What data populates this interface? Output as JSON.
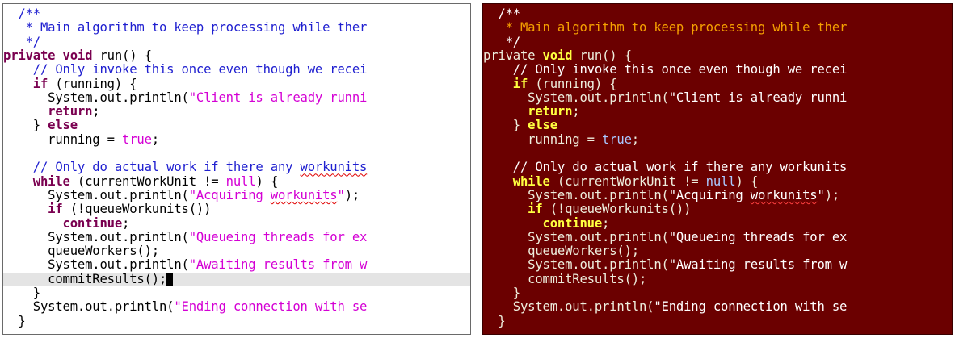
{
  "editors": [
    {
      "theme": "light",
      "lines": [
        [
          {
            "t": "  /**",
            "c": "cm"
          }
        ],
        [
          {
            "t": "   * Main algorithm to keep processing while ther",
            "c": "cm"
          }
        ],
        [
          {
            "t": "   */",
            "c": "cm"
          }
        ],
        [
          {
            "t": "private",
            "c": "kw"
          },
          {
            "t": " ",
            "c": "t"
          },
          {
            "t": "void",
            "c": "kw"
          },
          {
            "t": " run() {",
            "c": "t"
          }
        ],
        [
          {
            "t": "    // Only invoke this once even though we recei",
            "c": "cm"
          }
        ],
        [
          {
            "t": "    ",
            "c": "t"
          },
          {
            "t": "if",
            "c": "kw"
          },
          {
            "t": " (running) {",
            "c": "t"
          }
        ],
        [
          {
            "t": "      System.out.println(",
            "c": "t"
          },
          {
            "t": "\"Client is already runni",
            "c": "str"
          }
        ],
        [
          {
            "t": "      ",
            "c": "t"
          },
          {
            "t": "return",
            "c": "kw"
          },
          {
            "t": ";",
            "c": "t"
          }
        ],
        [
          {
            "t": "    } ",
            "c": "t"
          },
          {
            "t": "else",
            "c": "kw"
          }
        ],
        [
          {
            "t": "      running = ",
            "c": "t"
          },
          {
            "t": "true",
            "c": "str"
          },
          {
            "t": ";",
            "c": "t"
          }
        ],
        [],
        [
          {
            "t": "    // Only do actual work if there any ",
            "c": "cm"
          },
          {
            "t": "workunits",
            "c": "cm sq"
          }
        ],
        [
          {
            "t": "    ",
            "c": "t"
          },
          {
            "t": "while",
            "c": "kw"
          },
          {
            "t": " (currentWorkUnit != ",
            "c": "t"
          },
          {
            "t": "null",
            "c": "str"
          },
          {
            "t": ") {",
            "c": "t"
          }
        ],
        [
          {
            "t": "      System.out.println(",
            "c": "t"
          },
          {
            "t": "\"Acquiring ",
            "c": "str"
          },
          {
            "t": "workunits",
            "c": "str sq"
          },
          {
            "t": "\"",
            "c": "str"
          },
          {
            "t": ");",
            "c": "t"
          }
        ],
        [
          {
            "t": "      ",
            "c": "t"
          },
          {
            "t": "if",
            "c": "kw"
          },
          {
            "t": " (!queueWorkunits())",
            "c": "t"
          }
        ],
        [
          {
            "t": "        ",
            "c": "t"
          },
          {
            "t": "continue",
            "c": "kw"
          },
          {
            "t": ";",
            "c": "t"
          }
        ],
        [
          {
            "t": "      System.out.println(",
            "c": "t"
          },
          {
            "t": "\"Queueing threads for ex",
            "c": "str"
          }
        ],
        [
          {
            "t": "      queueWorkers();",
            "c": "t"
          }
        ],
        [
          {
            "t": "      System.out.println(",
            "c": "t"
          },
          {
            "t": "\"Awaiting results from w",
            "c": "str"
          }
        ],
        [
          {
            "t": "      commitResults();",
            "c": "t"
          }
        ],
        [
          {
            "t": "    }",
            "c": "t"
          }
        ],
        [
          {
            "t": "    System.out.println(",
            "c": "t"
          },
          {
            "t": "\"Ending connection with se",
            "c": "str"
          }
        ],
        [
          {
            "t": "  }",
            "c": "t"
          }
        ]
      ]
    },
    {
      "theme": "dark",
      "lines": [
        [
          {
            "t": "  /**",
            "c": "cm"
          }
        ],
        [
          {
            "t": "   * Main algorithm to keep processing while ther",
            "c": "cm2"
          }
        ],
        [
          {
            "t": "   */",
            "c": "cm"
          }
        ],
        [
          {
            "t": "private",
            "c": "t"
          },
          {
            "t": " ",
            "c": "t"
          },
          {
            "t": "void",
            "c": "kw"
          },
          {
            "t": " run() {",
            "c": "t"
          }
        ],
        [
          {
            "t": "    // Only invoke this once even though we recei",
            "c": "cm"
          }
        ],
        [
          {
            "t": "    ",
            "c": "t"
          },
          {
            "t": "if",
            "c": "kw"
          },
          {
            "t": " (running) {",
            "c": "t"
          }
        ],
        [
          {
            "t": "      System.out.println(",
            "c": "t"
          },
          {
            "t": "\"Client is already runni",
            "c": "str"
          }
        ],
        [
          {
            "t": "      ",
            "c": "t"
          },
          {
            "t": "return",
            "c": "kw"
          },
          {
            "t": ";",
            "c": "t"
          }
        ],
        [
          {
            "t": "    } ",
            "c": "t"
          },
          {
            "t": "else",
            "c": "kw"
          }
        ],
        [
          {
            "t": "      running = ",
            "c": "t"
          },
          {
            "t": "true",
            "c": "lit"
          },
          {
            "t": ";",
            "c": "t"
          }
        ],
        [],
        [
          {
            "t": "    // Only do actual work if there any workunits",
            "c": "cm"
          }
        ],
        [
          {
            "t": "    ",
            "c": "t"
          },
          {
            "t": "while",
            "c": "kw"
          },
          {
            "t": " (currentWorkUnit != ",
            "c": "t"
          },
          {
            "t": "null",
            "c": "lit"
          },
          {
            "t": ") {",
            "c": "t"
          }
        ],
        [
          {
            "t": "      System.out.println(",
            "c": "t"
          },
          {
            "t": "\"Acquiring ",
            "c": "str"
          },
          {
            "t": "workunits",
            "c": "str sq"
          },
          {
            "t": "\"",
            "c": "str"
          },
          {
            "t": ");",
            "c": "t"
          }
        ],
        [
          {
            "t": "      ",
            "c": "t"
          },
          {
            "t": "if",
            "c": "kw"
          },
          {
            "t": " (!queueWorkunits())",
            "c": "t"
          }
        ],
        [
          {
            "t": "        ",
            "c": "t"
          },
          {
            "t": "continue",
            "c": "kw"
          },
          {
            "t": ";",
            "c": "t"
          }
        ],
        [
          {
            "t": "      System.out.println(",
            "c": "t"
          },
          {
            "t": "\"Queueing threads for ex",
            "c": "str"
          }
        ],
        [
          {
            "t": "      queueWorkers();",
            "c": "t"
          }
        ],
        [
          {
            "t": "      System.out.println(",
            "c": "t"
          },
          {
            "t": "\"Awaiting results from w",
            "c": "str"
          }
        ],
        [
          {
            "t": "      commitResults();",
            "c": "t"
          }
        ],
        [
          {
            "t": "    }",
            "c": "t"
          }
        ],
        [
          {
            "t": "    System.out.println(",
            "c": "t"
          },
          {
            "t": "\"Ending connection with se",
            "c": "str"
          }
        ],
        [
          {
            "t": "  }",
            "c": "t"
          }
        ]
      ]
    }
  ]
}
